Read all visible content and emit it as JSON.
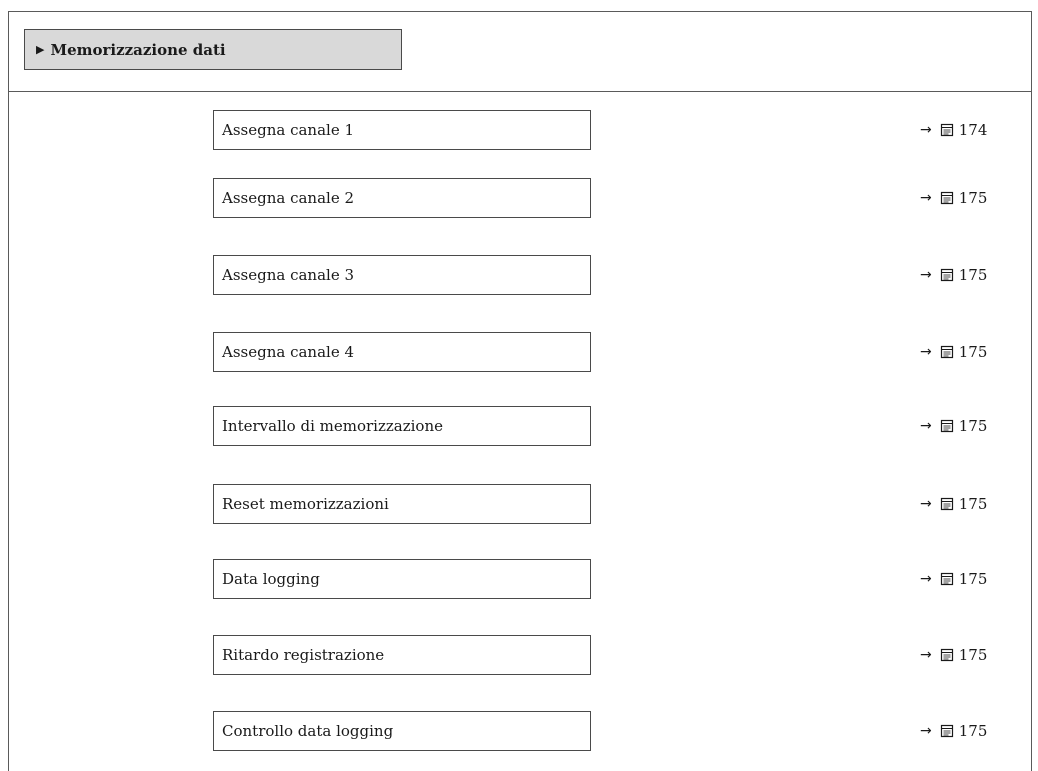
{
  "section": {
    "marker": "▶",
    "title": "Memorizzazione dati"
  },
  "params": [
    {
      "label": "Assegna canale 1",
      "arrow": "→",
      "page": "174"
    },
    {
      "label": "Assegna canale 2",
      "arrow": "→",
      "page": "175"
    },
    {
      "label": "Assegna canale 3",
      "arrow": "→",
      "page": "175"
    },
    {
      "label": "Assegna canale 4",
      "arrow": "→",
      "page": "175"
    },
    {
      "label": "Intervallo di memorizzazione",
      "arrow": "→",
      "page": "175"
    },
    {
      "label": "Reset memorizzazioni",
      "arrow": "→",
      "page": "175"
    },
    {
      "label": "Data logging",
      "arrow": "→",
      "page": "175"
    },
    {
      "label": "Ritardo registrazione",
      "arrow": "→",
      "page": "175"
    },
    {
      "label": "Controllo data logging",
      "arrow": "→",
      "page": "175"
    }
  ],
  "icons": {
    "reference": "arrow-right-icon",
    "page": "book-page-icon"
  }
}
